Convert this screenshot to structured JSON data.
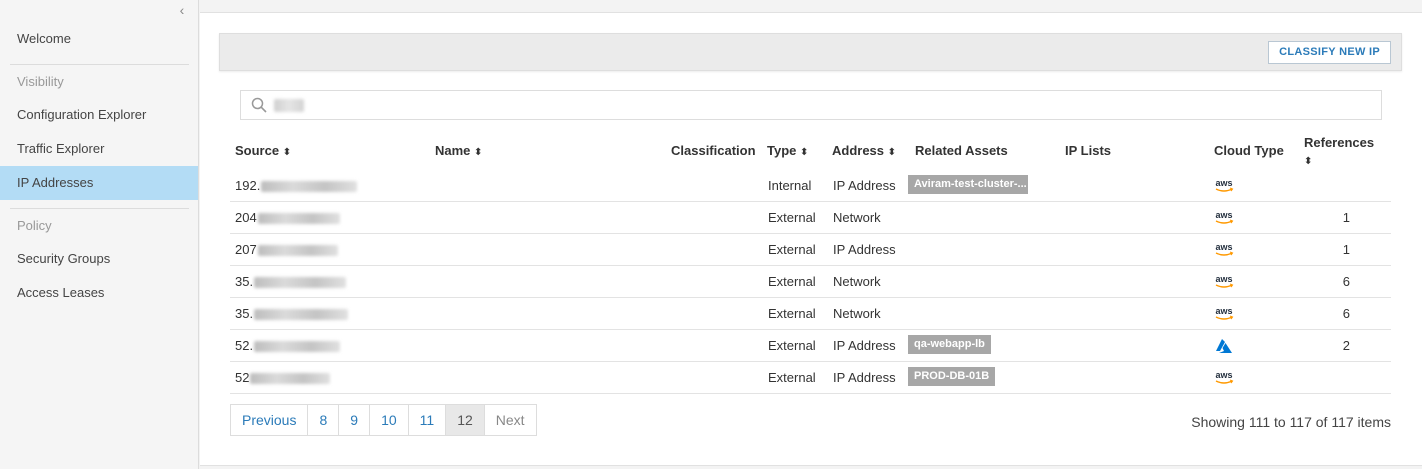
{
  "sidebar": {
    "collapse_glyph": "‹",
    "items": [
      {
        "label": "Welcome"
      },
      {
        "label": "Configuration Explorer"
      },
      {
        "label": "Traffic Explorer"
      },
      {
        "label": "IP Addresses"
      },
      {
        "label": "Security Groups"
      },
      {
        "label": "Access Leases"
      }
    ],
    "sections": {
      "visibility": "Visibility",
      "policy": "Policy"
    }
  },
  "toolbar": {
    "classify_label": "CLASSIFY NEW IP"
  },
  "search": {
    "value": "",
    "placeholder": ""
  },
  "table": {
    "headers": {
      "source": "Source",
      "name": "Name",
      "classification": "Classification",
      "type": "Type",
      "address": "Address",
      "related_assets": "Related Assets",
      "ip_lists": "IP Lists",
      "cloud_type": "Cloud Type",
      "references": "References"
    },
    "sort_glyph": "⬍",
    "rows": [
      {
        "source": "192.",
        "type": "Internal",
        "address": "IP Address",
        "related": "Aviram-test-cluster-...",
        "cloud": "aws",
        "references": ""
      },
      {
        "source": "204",
        "type": "External",
        "address": "Network",
        "related": "",
        "cloud": "aws",
        "references": "1"
      },
      {
        "source": "207",
        "type": "External",
        "address": "IP Address",
        "related": "",
        "cloud": "aws",
        "references": "1"
      },
      {
        "source": "35.",
        "type": "External",
        "address": "Network",
        "related": "",
        "cloud": "aws",
        "references": "6"
      },
      {
        "source": "35.",
        "type": "External",
        "address": "Network",
        "related": "",
        "cloud": "aws",
        "references": "6"
      },
      {
        "source": "52.",
        "type": "External",
        "address": "IP Address",
        "related": "qa-webapp-lb",
        "cloud": "azure",
        "references": "2"
      },
      {
        "source": "52",
        "type": "External",
        "address": "IP Address",
        "related": "PROD-DB-01B",
        "cloud": "aws",
        "references": ""
      }
    ]
  },
  "pagination": {
    "previous": "Previous",
    "pages": [
      "8",
      "9",
      "10",
      "11",
      "12"
    ],
    "current": "12",
    "next": "Next",
    "summary": "Showing 111 to 117 of 117 items"
  },
  "colors": {
    "accent": "#2b7bb9",
    "active_nav": "#b3dcf5",
    "tag": "#a7a7a7",
    "aws_orange": "#ff9900",
    "azure_blue": "#0078d4"
  }
}
